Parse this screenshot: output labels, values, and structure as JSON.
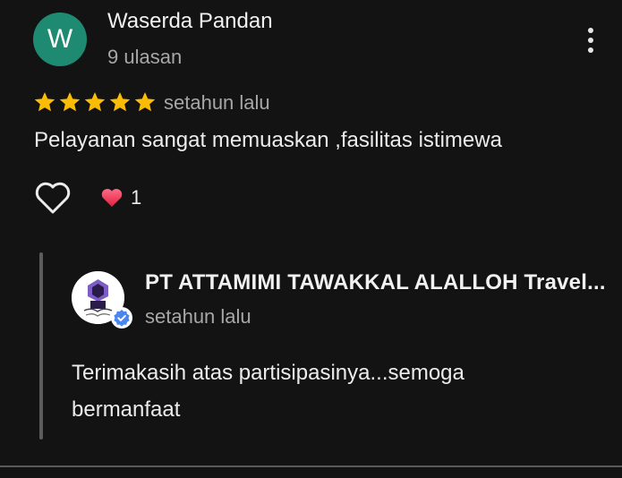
{
  "review": {
    "avatar_letter": "W",
    "avatar_color": "#1f8a72",
    "reviewer_name": "Waserda Pandan",
    "review_count": "9 ulasan",
    "rating": 5,
    "rating_max": 5,
    "star_color": "#fbbc04",
    "date": "setahun lalu",
    "text": "Pelayanan sangat memuaskan ,fasilitas istimewa",
    "reaction_count": "1",
    "icons": {
      "menu": "more-vertical-icon",
      "like": "heart-outline-icon",
      "reaction": "heart-filled-icon"
    }
  },
  "reply": {
    "owner_name": "PT ATTAMIMI TAWAKKAL ALALLOH Travel...",
    "date": "setahun lalu",
    "text_line1": "Terimakasih atas partisipasinya...semoga",
    "text_line2": "bermanfaat",
    "verified_color": "#4a86f0",
    "icons": {
      "badge": "verified-check-icon",
      "logo": "company-logo-icon"
    }
  }
}
